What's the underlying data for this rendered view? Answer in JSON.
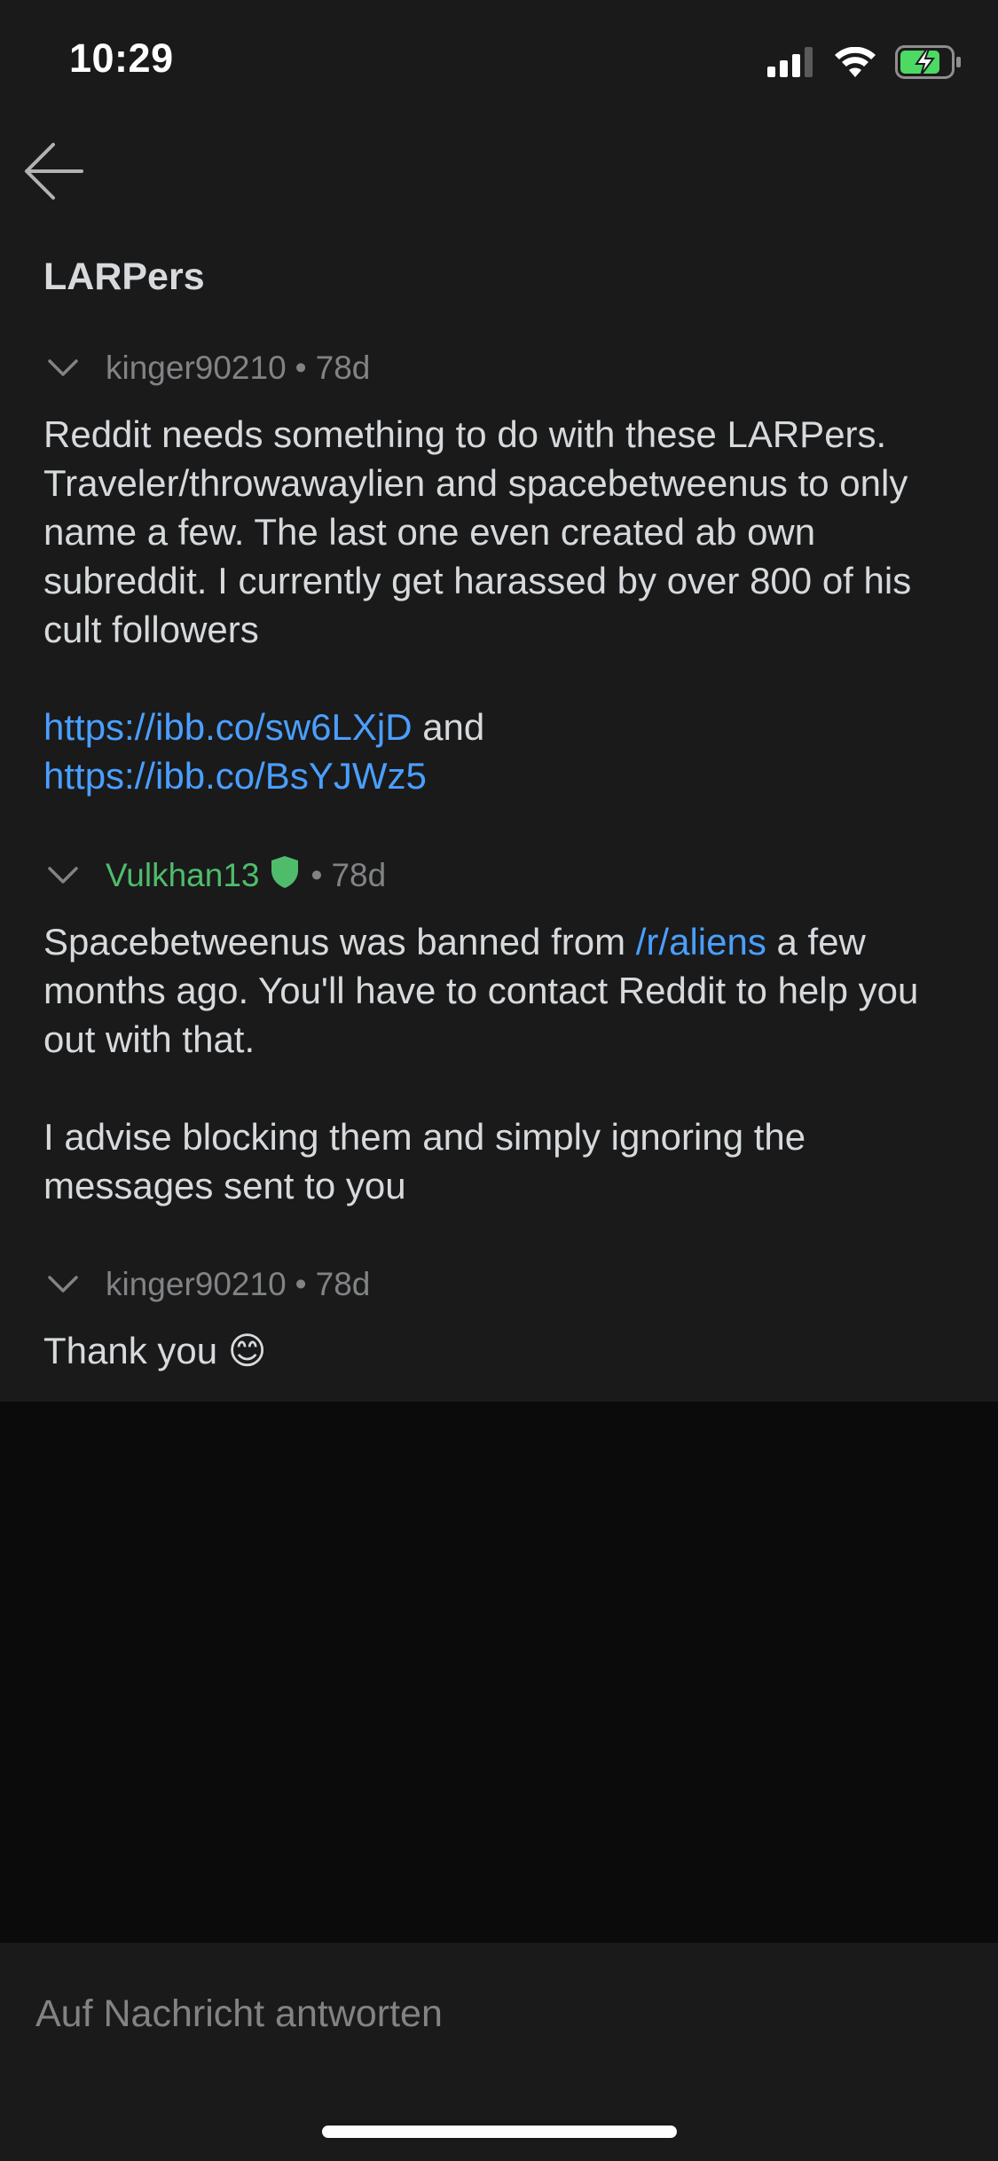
{
  "status_bar": {
    "time": "10:29",
    "icons": [
      "cellular-signal-icon",
      "wifi-icon",
      "battery-charging-icon"
    ]
  },
  "header": {
    "back_icon": "arrow-left-icon",
    "title": "LARPers"
  },
  "messages": [
    {
      "author": "kinger90210",
      "is_mod": false,
      "age": "78d",
      "body_text": "Reddit needs something to do with these LARPers. Traveler/throwawaylien and spacebetweenus to only name a few. The last one even created ab own subreddit. I currently get harassed by over 800 of his cult followers",
      "link1": "https://ibb.co/sw6LXjD",
      "link_joiner": " and",
      "link2": "https://ibb.co/BsYJWz5"
    },
    {
      "author": "Vulkhan13",
      "is_mod": true,
      "mod_icon": "shield-icon",
      "age": "78d",
      "body_pre": "Spacebetweenus was banned from ",
      "body_link": "/r/aliens",
      "body_post": " a few months ago. You'll have to contact Reddit to help you out with that.",
      "body_p2": "I advise blocking them and simply ignoring the messages sent to you"
    },
    {
      "author": "kinger90210",
      "is_mod": false,
      "age": "78d",
      "body_text": "Thank you 😊"
    }
  ],
  "reply": {
    "placeholder": "Auf Nachricht antworten"
  },
  "colors": {
    "background": "#1a1a1b",
    "lower_background": "#0b0b0b",
    "text": "#d7dadc",
    "muted": "#818384",
    "link": "#4a9fff",
    "mod_green": "#4fbc6b"
  }
}
